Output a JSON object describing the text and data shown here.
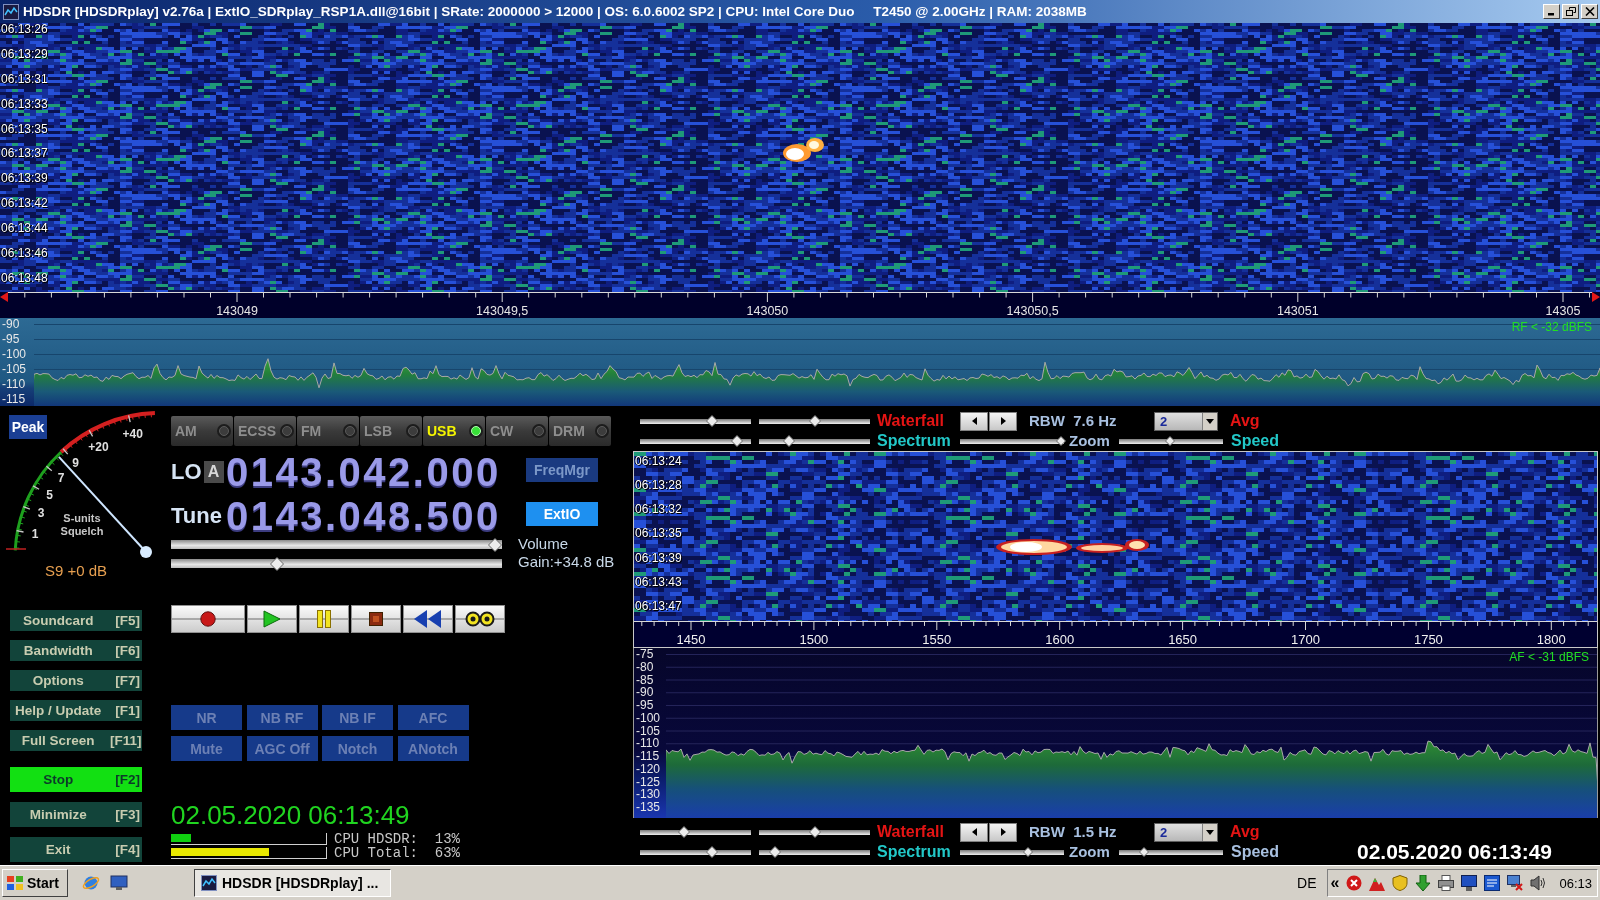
{
  "window": {
    "title": "HDSDR [HDSDRplay] v2.76a | ExtIO_SDRplay_RSP1A.dll@16bit | SRate: 2000000 > 12000 | OS: 6.0.6002 SP2 | CPU: Intel Core Duo     T2450 @ 2.00GHz | RAM: 2038MB"
  },
  "rf_waterfall": {
    "time_labels": [
      "06:13:26",
      "06:13:29",
      "06:13:31",
      "06:13:33",
      "06:13:35",
      "06:13:37",
      "06:13:39",
      "06:13:42",
      "06:13:44",
      "06:13:46",
      "06:13:48"
    ]
  },
  "rf_axis": {
    "labels": [
      "143049",
      "143049,5",
      "143050",
      "143050,5",
      "143051",
      "14305"
    ]
  },
  "rf_spectrum": {
    "y_labels": [
      "-90",
      "-95",
      "-100",
      "-105",
      "-110",
      "-115"
    ],
    "readout": "RF < -32 dBFS"
  },
  "s_meter": {
    "peak_button": "Peak",
    "scale": [
      "1",
      "3",
      "5",
      "7",
      "9",
      "+20",
      "+40"
    ],
    "captions": [
      "S-units",
      "Squelch"
    ],
    "reading": "S9 +0 dB"
  },
  "modes": [
    {
      "label": "AM",
      "selected": false
    },
    {
      "label": "ECSS",
      "selected": false
    },
    {
      "label": "FM",
      "selected": false
    },
    {
      "label": "LSB",
      "selected": false
    },
    {
      "label": "USB",
      "selected": true
    },
    {
      "label": "CW",
      "selected": false
    },
    {
      "label": "DRM",
      "selected": false
    }
  ],
  "vfo": {
    "lo_label": "LO",
    "lo_bank": "A",
    "lo_frequency": "0143.042.000",
    "tune_label": "Tune",
    "tune_frequency": "0143.048.500"
  },
  "side_buttons": [
    {
      "label": "FreqMgr",
      "selected": false
    },
    {
      "label": "ExtIO",
      "selected": true
    }
  ],
  "audio": {
    "volume": {
      "label": "Volume",
      "level": 0.98
    },
    "gain": {
      "label": "Gain:+34.8 dB",
      "level": 0.32
    }
  },
  "function_buttons": [
    {
      "label": "Soundcard",
      "key": "[F5]",
      "on": false
    },
    {
      "label": "Bandwidth",
      "key": "[F6]",
      "on": false
    },
    {
      "label": "Options",
      "key": "[F7]",
      "on": false
    },
    {
      "label": "Help / Update",
      "key": "[F1]",
      "on": false
    },
    {
      "label": "Full Screen",
      "key": "[F11]",
      "on": false
    },
    {
      "label": "Stop",
      "key": "[F2]",
      "on": true
    },
    {
      "label": "Minimize",
      "key": "[F3]",
      "on": false
    },
    {
      "label": "Exit",
      "key": "[F4]",
      "on": false
    }
  ],
  "transport": [
    {
      "kind": "record"
    },
    {
      "kind": "play"
    },
    {
      "kind": "pause"
    },
    {
      "kind": "stop"
    },
    {
      "kind": "rewind"
    },
    {
      "kind": "loop"
    }
  ],
  "dsp_buttons": [
    "NR",
    "NB RF",
    "NB IF",
    "AFC",
    "Mute",
    "AGC Off",
    "Notch",
    "ANotch"
  ],
  "status": {
    "datetime": "02.05.2020 06:13:49",
    "cpu": [
      {
        "label": "CPU HDSDR:  13%",
        "level": 0.13,
        "color": "#10d010"
      },
      {
        "label": "CPU Total:  63%",
        "level": 0.63,
        "color": "#e8e800"
      }
    ]
  },
  "af_controls_top": {
    "waterfall_sliders": [
      {
        "level": 0.65
      },
      {
        "level": 0.5
      }
    ],
    "waterfall_label": "Waterfall",
    "rbw": "RBW  7.6 Hz",
    "avg_value": "2",
    "avg_label": "Avg",
    "spectrum_sliders": [
      {
        "level": 0.87
      },
      {
        "level": 0.27
      }
    ],
    "spectrum_label": "Spectrum",
    "zoom": {
      "level": 0.97
    },
    "zoom_label": "Zoom",
    "speed": {
      "level": 0.49
    },
    "speed_label": "Speed",
    "speed_highlighted": true
  },
  "af_waterfall": {
    "time_labels": [
      "06:13:24",
      "06:13:28",
      "06:13:32",
      "06:13:35",
      "06:13:39",
      "06:13:43",
      "06:13:47"
    ]
  },
  "af_axis": {
    "labels": [
      "1450",
      "1500",
      "1550",
      "1600",
      "1650",
      "1700",
      "1750",
      "1800"
    ]
  },
  "af_spectrum": {
    "y_labels": [
      "-75",
      "-80",
      "-85",
      "-90",
      "-95",
      "-100",
      "-105",
      "-110",
      "-115",
      "-120",
      "-125",
      "-130",
      "-135"
    ],
    "readout": "AF < -31 dBFS"
  },
  "af_controls_bottom": {
    "waterfall_sliders": [
      {
        "level": 0.4
      },
      {
        "level": 0.5
      }
    ],
    "waterfall_label": "Waterfall",
    "rbw": "RBW  1.5 Hz",
    "avg_value": "2",
    "avg_label": "Avg",
    "spectrum_sliders": [
      {
        "level": 0.65
      },
      {
        "level": 0.14
      }
    ],
    "spectrum_label": "Spectrum",
    "zoom": {
      "level": 0.65
    },
    "zoom_label": "Zoom",
    "speed": {
      "level": 0.24
    },
    "speed_label": "Speed",
    "speed_highlighted": false
  },
  "overlay_clock": "02.05.2020 06:13:49",
  "taskbar": {
    "start": "Start",
    "task": "HDSDR [HDSDRplay] ...",
    "language": "DE",
    "tray_toggle": "«",
    "clock": "06:13"
  }
}
